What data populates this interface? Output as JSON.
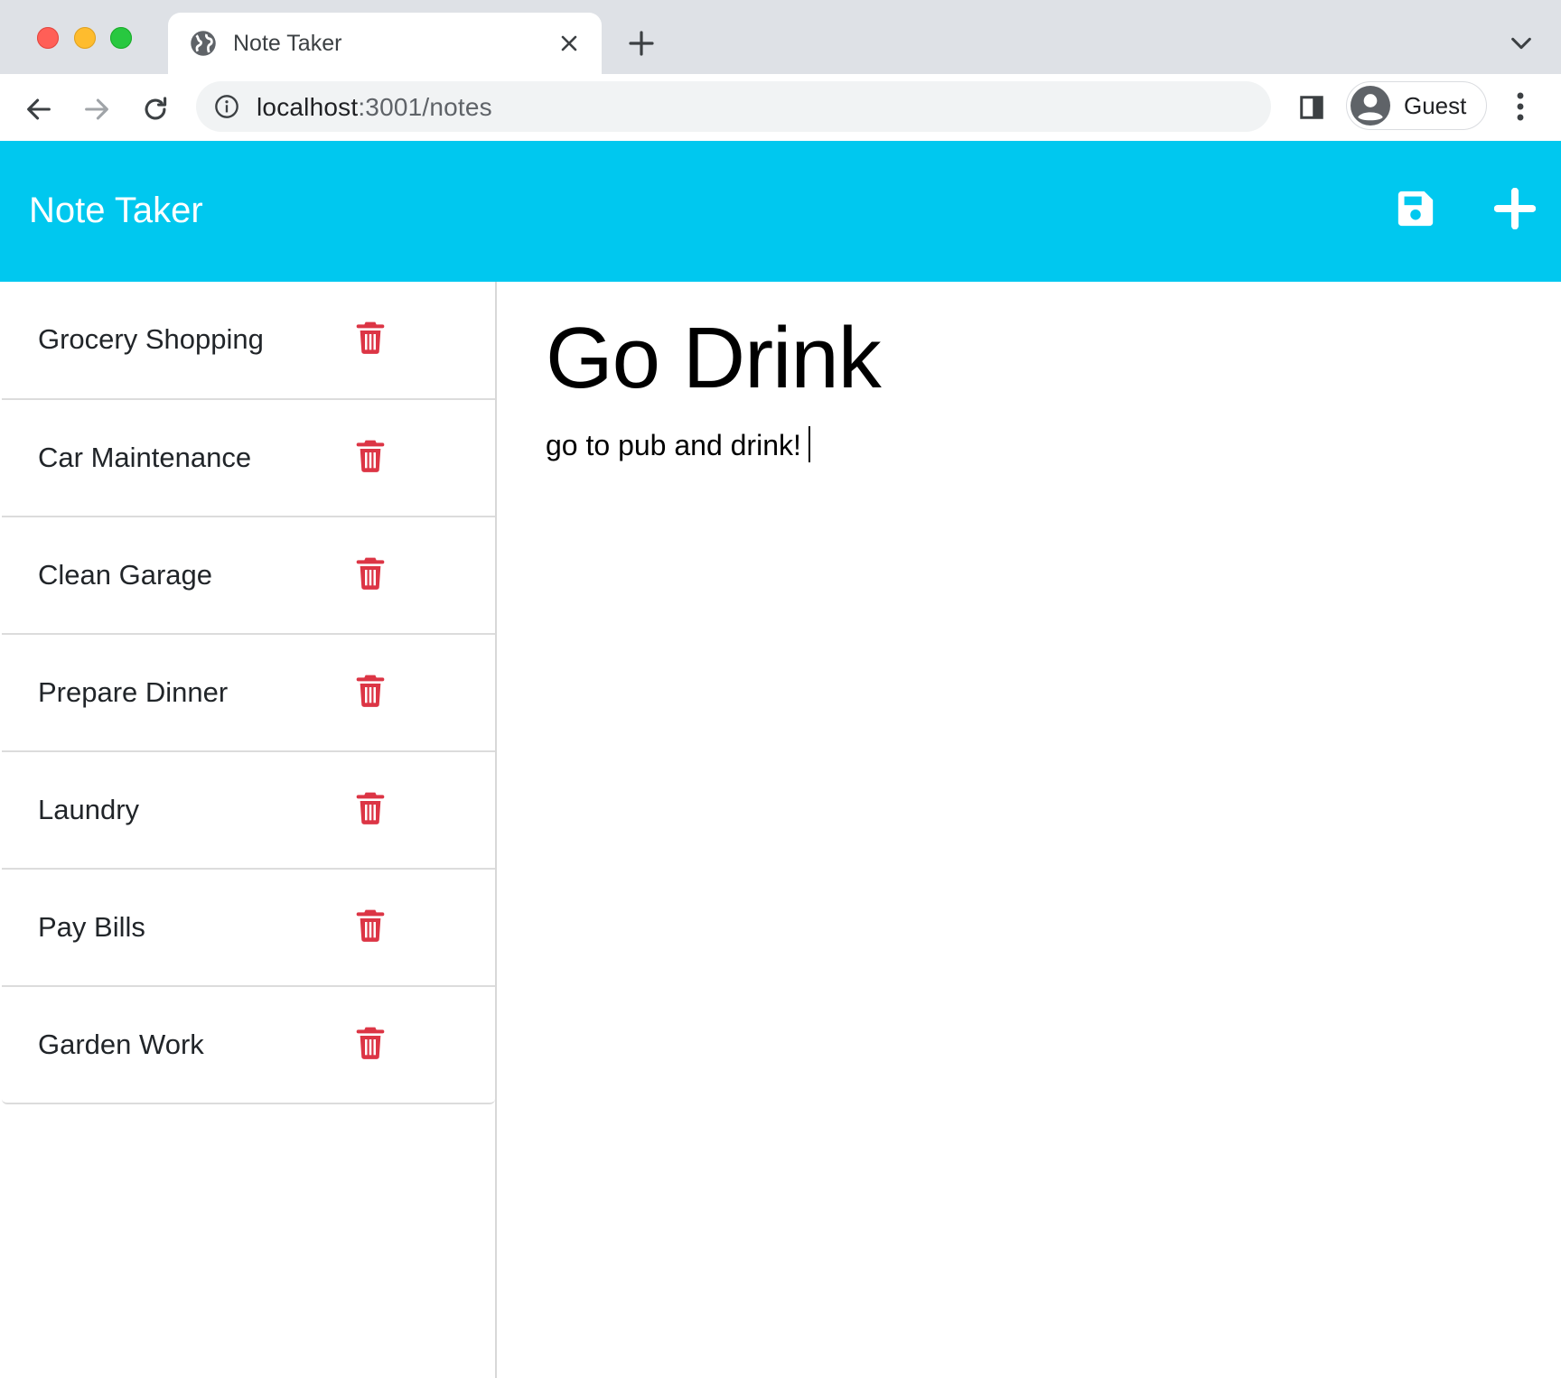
{
  "browser": {
    "tab_title": "Note Taker",
    "url_host": "localhost",
    "url_path": ":3001/notes",
    "profile_name": "Guest",
    "icons": [
      "globe-icon",
      "close-icon",
      "plus-icon",
      "chevron-down-icon",
      "back-arrow-icon",
      "forward-arrow-icon",
      "reload-icon",
      "info-icon",
      "side-panel-icon",
      "avatar-icon",
      "kebab-menu-icon"
    ]
  },
  "app": {
    "title": "Note Taker",
    "accent_color": "#00c8ef",
    "icons": {
      "save": "save-icon",
      "new_note": "plus-icon",
      "delete": "trash-icon"
    },
    "delete_color": "#dc3545"
  },
  "notes": [
    {
      "title": "Grocery Shopping"
    },
    {
      "title": "Car Maintenance"
    },
    {
      "title": "Clean Garage"
    },
    {
      "title": "Prepare Dinner"
    },
    {
      "title": "Laundry"
    },
    {
      "title": "Pay Bills"
    },
    {
      "title": "Garden Work"
    }
  ],
  "active_note": {
    "title": "Go Drink",
    "text": "go to pub and drink!"
  }
}
